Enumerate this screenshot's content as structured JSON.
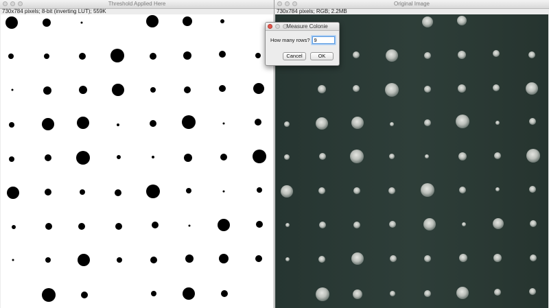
{
  "left_window": {
    "title": "Threshold Applied Here",
    "info": "730x784 pixels; 8-bit (inverting LUT); 559K"
  },
  "right_window": {
    "title": "Original Image",
    "info": "730x784 pixels; RGB; 2.2MB"
  },
  "dialog": {
    "title": "Measure Colonie",
    "prompt": "How many rows?",
    "input_value": "9",
    "cancel_label": "Cancel",
    "ok_label": "OK"
  },
  "colors": {
    "threshold_background": "#ffffff",
    "threshold_colony": "#000000",
    "plate_background": "#2a3a35",
    "close_button": "#e2574c"
  },
  "icons": [
    "close-icon",
    "minimize-icon",
    "zoom-icon"
  ]
}
